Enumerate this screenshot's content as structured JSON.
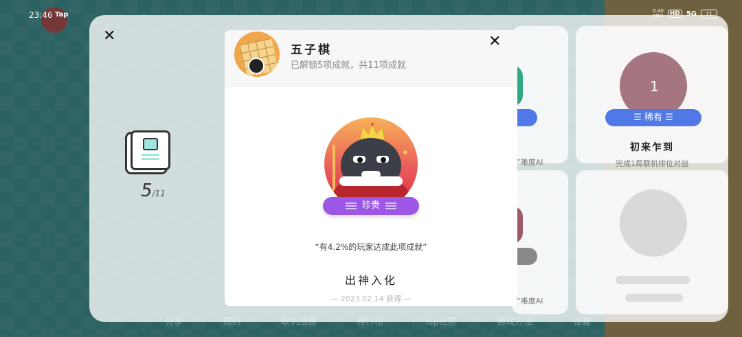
{
  "status_bar": {
    "time": "23:46",
    "app_badge": "Tap",
    "net_speed": "0.40\nKB/s",
    "hd": "HD",
    "network": "5G",
    "battery": "71"
  },
  "background_panel": {
    "unlocked_count": "5",
    "total_count": "/11",
    "cards": [
      {
        "title": "初来乍到",
        "rarity": "稀有",
        "desc": "完成1局联机排位对战",
        "badge_num": "1"
      }
    ],
    "mid_descs": [
      "”难度AI",
      "”难度AI"
    ],
    "bottom_nav": [
      "分享",
      "规则",
      "联机战绩",
      "排行榜",
      "Tap社区",
      "游戏方法",
      "设置"
    ]
  },
  "modal": {
    "game_name": "五子棋",
    "summary": "已解锁5项成就，共11项成就",
    "achievement": {
      "rarity": "珍贵",
      "quote": "“有4.2%的玩家达成此项成就”",
      "title": "出神入化",
      "date": "— 2023.02.14 获得 —"
    }
  },
  "colors": {
    "rarity_precious": "#9c57e6",
    "rarity_rare": "#5078e6",
    "badge_gradient_top": "#f7b25a",
    "badge_gradient_bottom": "#d83040"
  },
  "icons": {
    "modal_close": "close-icon",
    "panel_close": "close-icon",
    "stat": "album-icon",
    "game": "gomoku-board-icon"
  }
}
